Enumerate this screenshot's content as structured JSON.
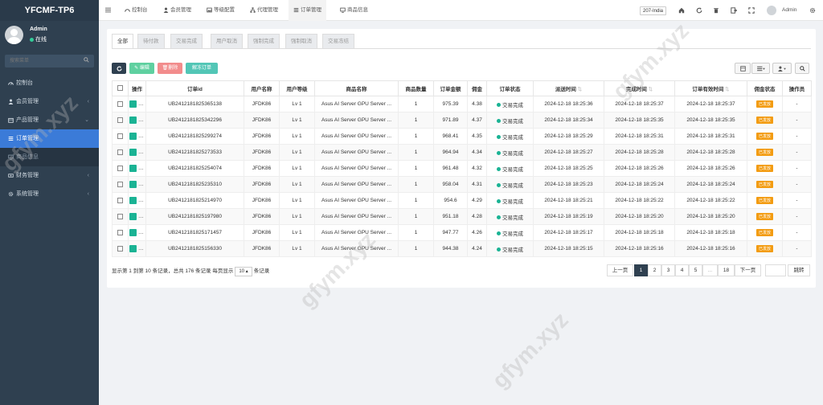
{
  "sidebar": {
    "logo": "YFCMF-TP6",
    "user_name": "Admin",
    "user_status": "在线",
    "search_placeholder": "搜索菜单",
    "items": [
      {
        "label": "控制台",
        "icon": "dashboard-icon",
        "arrow": ""
      },
      {
        "label": "会员管理",
        "icon": "user-icon",
        "arrow": "‹"
      },
      {
        "label": "产品管理",
        "icon": "box-icon",
        "arrow": "⌄"
      },
      {
        "label": "订单管理",
        "icon": "list-icon",
        "arrow": ""
      },
      {
        "label": "商品信息",
        "icon": "monitor-icon",
        "arrow": ""
      },
      {
        "label": "财务管理",
        "icon": "money-icon",
        "arrow": "‹"
      },
      {
        "label": "系统管理",
        "icon": "gear-icon",
        "arrow": "‹"
      }
    ]
  },
  "topbar": {
    "nav": [
      "控制台",
      "会员管理",
      "等级配置",
      "代理管理",
      "订单管理",
      "商品信息"
    ],
    "region": "207-India",
    "admin": "Admin"
  },
  "tabs": [
    "全部",
    "待付款",
    "交易完成",
    "用户取消",
    "强制完成",
    "强制取消",
    "交易冻结"
  ],
  "toolbar": {
    "edit": "编辑",
    "delete": "删除",
    "unfreeze": "解冻订单"
  },
  "table": {
    "headers": [
      "操作",
      "订单id",
      "用户名称",
      "用户等级",
      "商品名称",
      "商品数量",
      "订单金额",
      "佣金",
      "订单状态",
      "派送时间",
      "完成时间",
      "订单有效时间",
      "佣金状态",
      "操作员"
    ],
    "rows": [
      [
        "UB2412181825365138",
        "JFDK86",
        "Lv 1",
        "Asus AI Server GPU Server ...",
        "1",
        "975.39",
        "4.38",
        "交易完成",
        "2024-12-18 18:25:36",
        "2024-12-18 18:25:37",
        "2024-12-18 18:25:37",
        "已发放",
        "-"
      ],
      [
        "UB2412181825342296",
        "JFDK86",
        "Lv 1",
        "Asus AI Server GPU Server ...",
        "1",
        "971.89",
        "4.37",
        "交易完成",
        "2024-12-18 18:25:34",
        "2024-12-18 18:25:35",
        "2024-12-18 18:25:35",
        "已发放",
        "-"
      ],
      [
        "UB2412181825299274",
        "JFDK86",
        "Lv 1",
        "Asus AI Server GPU Server ...",
        "1",
        "968.41",
        "4.35",
        "交易完成",
        "2024-12-18 18:25:29",
        "2024-12-18 18:25:31",
        "2024-12-18 18:25:31",
        "已发放",
        "-"
      ],
      [
        "UB2412181825273533",
        "JFDK86",
        "Lv 1",
        "Asus AI Server GPU Server ...",
        "1",
        "964.94",
        "4.34",
        "交易完成",
        "2024-12-18 18:25:27",
        "2024-12-18 18:25:28",
        "2024-12-18 18:25:28",
        "已发放",
        "-"
      ],
      [
        "UB2412181825254074",
        "JFDK86",
        "Lv 1",
        "Asus AI Server GPU Server ...",
        "1",
        "961.48",
        "4.32",
        "交易完成",
        "2024-12-18 18:25:25",
        "2024-12-18 18:25:26",
        "2024-12-18 18:25:26",
        "已发放",
        "-"
      ],
      [
        "UB2412181825235310",
        "JFDK86",
        "Lv 1",
        "Asus AI Server GPU Server ...",
        "1",
        "958.04",
        "4.31",
        "交易完成",
        "2024-12-18 18:25:23",
        "2024-12-18 18:25:24",
        "2024-12-18 18:25:24",
        "已发放",
        "-"
      ],
      [
        "UB2412181825214970",
        "JFDK86",
        "Lv 1",
        "Asus AI Server GPU Server ...",
        "1",
        "954.6",
        "4.29",
        "交易完成",
        "2024-12-18 18:25:21",
        "2024-12-18 18:25:22",
        "2024-12-18 18:25:22",
        "已发放",
        "-"
      ],
      [
        "UB2412181825197980",
        "JFDK86",
        "Lv 1",
        "Asus AI Server GPU Server ...",
        "1",
        "951.18",
        "4.28",
        "交易完成",
        "2024-12-18 18:25:19",
        "2024-12-18 18:25:20",
        "2024-12-18 18:25:20",
        "已发放",
        "-"
      ],
      [
        "UB2412181825171457",
        "JFDK86",
        "Lv 1",
        "Asus AI Server GPU Server ...",
        "1",
        "947.77",
        "4.26",
        "交易完成",
        "2024-12-18 18:25:17",
        "2024-12-18 18:25:18",
        "2024-12-18 18:25:18",
        "已发放",
        "-"
      ],
      [
        "UB2412181825156330",
        "JFDK86",
        "Lv 1",
        "Asus AI Server GPU Server ...",
        "1",
        "944.38",
        "4.24",
        "交易完成",
        "2024-12-18 18:25:15",
        "2024-12-18 18:25:16",
        "2024-12-18 18:25:16",
        "已发放",
        "-"
      ]
    ]
  },
  "footer": {
    "info_prefix": "显示第 1 到第 10 条记录，总共 176 条记录 每页显示",
    "page_size": "10 ▴",
    "info_suffix": "条记录"
  },
  "pagination": {
    "prev": "上一页",
    "pages": [
      "1",
      "2",
      "3",
      "4",
      "5",
      "...",
      "18"
    ],
    "next": "下一页",
    "jump": "跳转"
  },
  "watermark": "gfym.xyz",
  "colors": {
    "sidebar": "#2f4050",
    "active": "#3b7bd8",
    "success": "#1ab394",
    "danger": "#ed5565",
    "warning": "#f39c12"
  }
}
